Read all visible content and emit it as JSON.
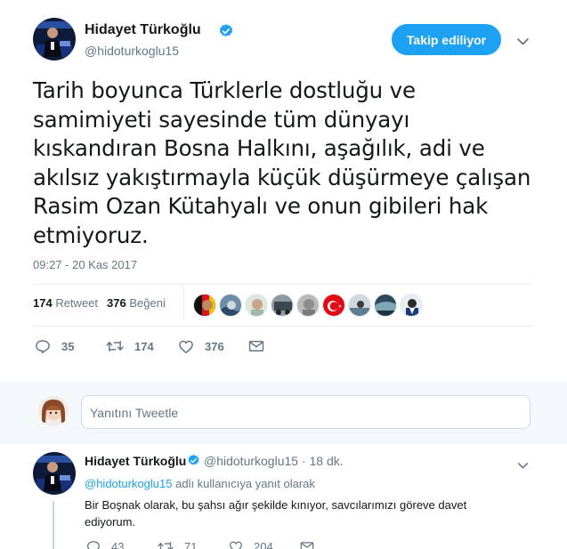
{
  "main_tweet": {
    "author_name": "Hidayet Türkoğlu",
    "handle": "@hidoturkoglu15",
    "follow_label": "Takip ediliyor",
    "text": "Tarih boyunca Türklerle dostluğu ve samimiyeti sayesinde tüm dünyayı kıskandıran Bosna Halkını, aşağılık, adi ve akılsız yakıştırmayla küçük düşürmeye çalışan Rasim Ozan Kütahyalı ve onun gibileri hak etmiyoruz.",
    "timestamp": "09:27 - 20 Kas 2017",
    "retweet_count": "174",
    "retweet_label": "Retweet",
    "like_count": "376",
    "like_label": "Beğeni",
    "actions": {
      "reply_count": "35",
      "retweet_count": "174",
      "like_count": "376"
    },
    "icons": [
      "verified-icon",
      "chevron-down-icon",
      "reply-icon",
      "retweet-icon",
      "heart-icon",
      "mail-icon"
    ]
  },
  "reply_box": {
    "placeholder": "Yanıtını Tweetle"
  },
  "reply_tweet": {
    "author_name": "Hidayet Türkoğlu",
    "handle": "@hidoturkoglu15",
    "time_ago": "· 18 dk.",
    "reply_to_handle": "@hidoturkoglu15",
    "reply_to_suffix": "adlı kullanıcıya yanıt olarak",
    "text": "Bir Boşnak olarak, bu şahsı ağır şekilde kınıyor, savcılarımızı göreve davet ediyorum.",
    "actions": {
      "reply_count": "43",
      "retweet_count": "71",
      "like_count": "204"
    }
  },
  "colors": {
    "accent": "#1da1f2",
    "muted": "#657786",
    "text": "#14171a",
    "divider": "#e6ecf0",
    "background_alt": "#f5f8fa"
  }
}
